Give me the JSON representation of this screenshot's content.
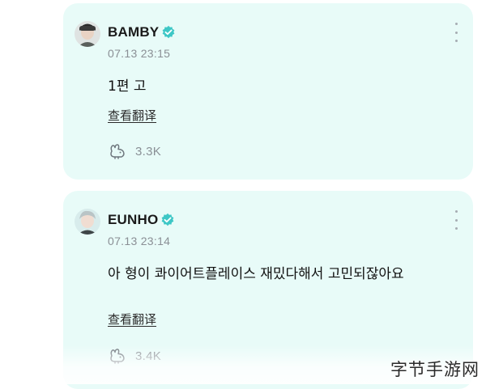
{
  "posts": [
    {
      "author": "BAMBY",
      "verified": true,
      "timestamp": "07.13 23:15",
      "text": "1편 고",
      "translate_label": "查看翻译",
      "like_count": "3.3K",
      "avatar_icon": "avatar-bamby-photo",
      "more_icon": "more-vertical-icon",
      "like_icon": "bunny-like-icon"
    },
    {
      "author": "EUNHO",
      "verified": true,
      "timestamp": "07.13 23:14",
      "text": "아 형이 콰이어트플레이스 재밌다해서 고민되잖아요",
      "translate_label": "查看翻译",
      "like_count": "3.4K",
      "avatar_icon": "avatar-eunho-photo",
      "more_icon": "more-vertical-icon",
      "like_icon": "bunny-like-icon"
    }
  ],
  "watermark": "字节手游网",
  "colors": {
    "card_background": "#e8fbf8",
    "verified_badge": "#3ec7c6",
    "timestamp": "#8a8f95",
    "like_count": "#8a9096"
  }
}
